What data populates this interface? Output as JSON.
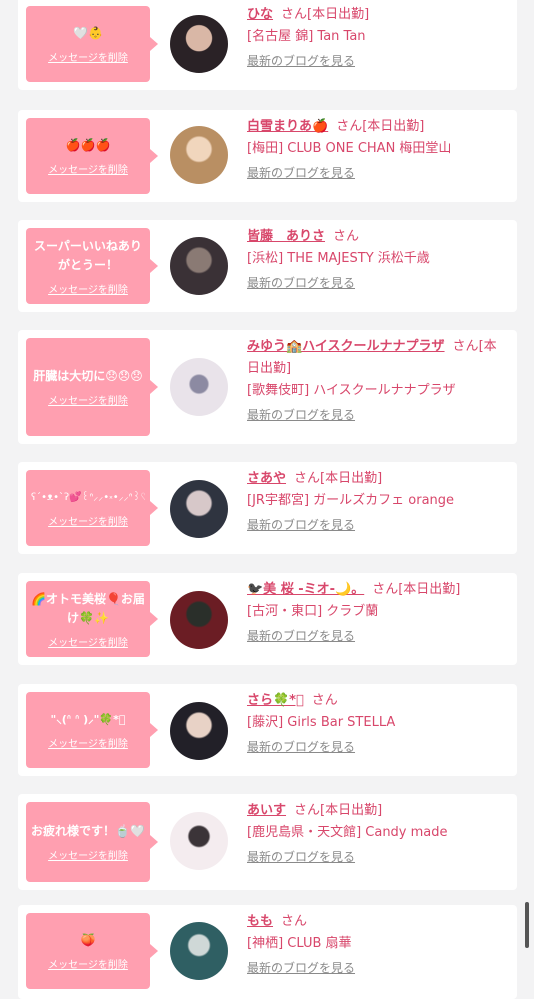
{
  "delete_label": "メッセージを削除",
  "blog_label": "最新のブログを見る",
  "san_label": "さん",
  "items": [
    {
      "message": "🤍👶",
      "name": "ひな",
      "status": "[本日出勤]",
      "shop": "[名古屋 錦] Tan Tan",
      "avatar_colors": [
        "#2a2226",
        "#d9b7a6"
      ]
    },
    {
      "message": "🍎🍎🍎",
      "name": "白雪まりあ🍎",
      "status": "[本日出勤]",
      "shop": "[梅田] CLUB ONE CHAN 梅田堂山",
      "avatar_colors": [
        "#b98f63",
        "#f1d6bd"
      ]
    },
    {
      "message": "スーパーいいねありがとうー！",
      "name": "皆藤　ありさ",
      "status": "",
      "shop": "[浜松] THE MAJESTY 浜松千歳",
      "avatar_colors": [
        "#3a3136",
        "#8a7a74"
      ]
    },
    {
      "message": "肝臓は大切に😞😞😞",
      "name": "みゆう🏫ハイスクールナナプラザ",
      "status": "[本日出勤]",
      "shop": "[歌舞伎町] ハイスクールナナプラザ",
      "avatar_colors": [
        "#e9e3ea",
        "#8c8aa2"
      ]
    },
    {
      "message": "ʕ´•ᴥ•`ʔ💕꒰ᐢ⸝⸝•༝•⸝⸝ᐢ꒱♡<3",
      "name": "さあや",
      "status": "[本日出勤]",
      "shop": "[JR宇都宮] ガールズカフェ orange",
      "avatar_colors": [
        "#2f3440",
        "#d7c8c9"
      ]
    },
    {
      "message": "🌈オトモ美桜🎈お届け🍀✨",
      "name": "🐦‍⬛美 桜 -ミオ-🌙。",
      "status": "[本日出勤]",
      "shop": "[古河・東口] クラブ蘭",
      "avatar_colors": [
        "#6b1d24",
        "#2a2f2a"
      ]
    },
    {
      "message": "\"⸜(ᐢ ᐢ )⸝\"🍀*゚",
      "name": "さら🍀*゚",
      "status": "",
      "shop": "[藤沢] Girls Bar STELLA",
      "avatar_colors": [
        "#222028",
        "#e8d2c6"
      ]
    },
    {
      "message": "お疲れ様です！🍵🤍",
      "name": "あいす",
      "status": "[本日出勤]",
      "shop": "[鹿児島県・天文館] Candy made",
      "avatar_colors": [
        "#f4ecef",
        "#3b3438"
      ]
    },
    {
      "message": "🍑",
      "name": "もも",
      "status": "",
      "shop": "[神栖] CLUB 扇華",
      "avatar_colors": [
        "#2f5f63",
        "#cfd8d7"
      ]
    }
  ]
}
